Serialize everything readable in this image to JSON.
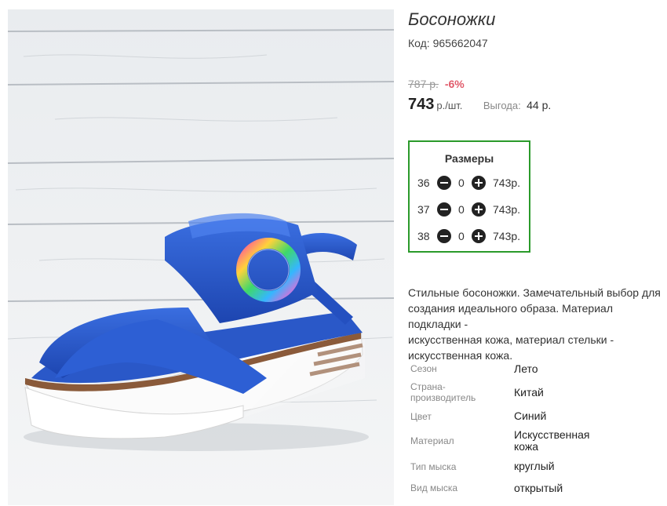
{
  "product": {
    "title": "Босоножки",
    "code": "Код: 965662047",
    "old_price": "787 р.",
    "discount": "-6%",
    "price": "743",
    "unit": "р./шт.",
    "benefit_label": "Выгода:",
    "benefit_value": "44 р."
  },
  "sizes": {
    "title": "Размеры",
    "rows": [
      {
        "size": "36",
        "qty": "0",
        "price": "743р."
      },
      {
        "size": "37",
        "qty": "0",
        "price": "743р."
      },
      {
        "size": "38",
        "qty": "0",
        "price": "743р."
      }
    ]
  },
  "description": "Стильные босоножки. Замечательный выбор для\nсоздания идеального образа. Материал подкладки -\nискусственная кожа, материал стельки -\nискусственная кожа.",
  "specs": [
    {
      "label": "Сезон",
      "value": "Лето"
    },
    {
      "label": "Страна-\nпроизводитель",
      "value": "Китай"
    },
    {
      "label": "Цвет",
      "value": "Синий"
    },
    {
      "label": "Материал",
      "value": "Искусственная\nкожа"
    },
    {
      "label": "Тип мыска",
      "value": "круглый"
    },
    {
      "label": "Вид мыска",
      "value": "открытый"
    }
  ],
  "colors": {
    "accent_green": "#2a9a2a",
    "discount_red": "#e05a6a",
    "sandal_blue": "#2453c4"
  }
}
